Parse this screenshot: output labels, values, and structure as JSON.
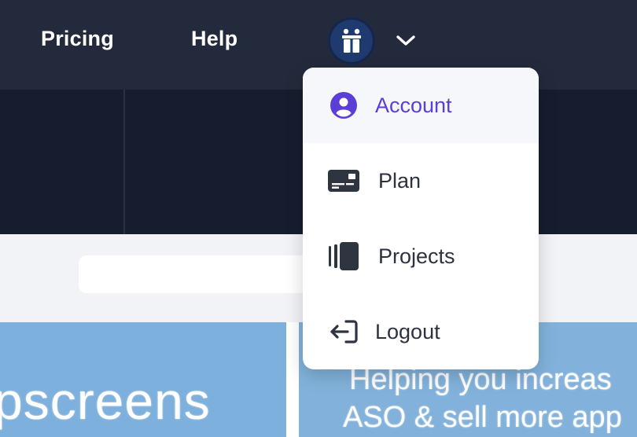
{
  "nav": {
    "links": [
      {
        "label": "Pricing"
      },
      {
        "label": "Help"
      }
    ],
    "avatar_icon": "gift-icon",
    "dropdown_icon": "chevron-down-icon"
  },
  "background": {
    "card_left_text": "pscreens",
    "card_right_lines": [
      "Helping you increas",
      "ASO & sell more app"
    ]
  },
  "menu": {
    "items": [
      {
        "label": "Account",
        "icon": "user-circle-icon",
        "active": true
      },
      {
        "label": "Plan",
        "icon": "credit-card-icon",
        "active": false
      },
      {
        "label": "Projects",
        "icon": "projects-stack-icon",
        "active": false
      },
      {
        "label": "Logout",
        "icon": "logout-icon",
        "active": false
      }
    ]
  },
  "colors": {
    "topbar": "#232a3b",
    "hero": "#161d2e",
    "accent": "#5b3ed6",
    "avatar": "#1f3a6e",
    "card": "#7db0dc"
  }
}
